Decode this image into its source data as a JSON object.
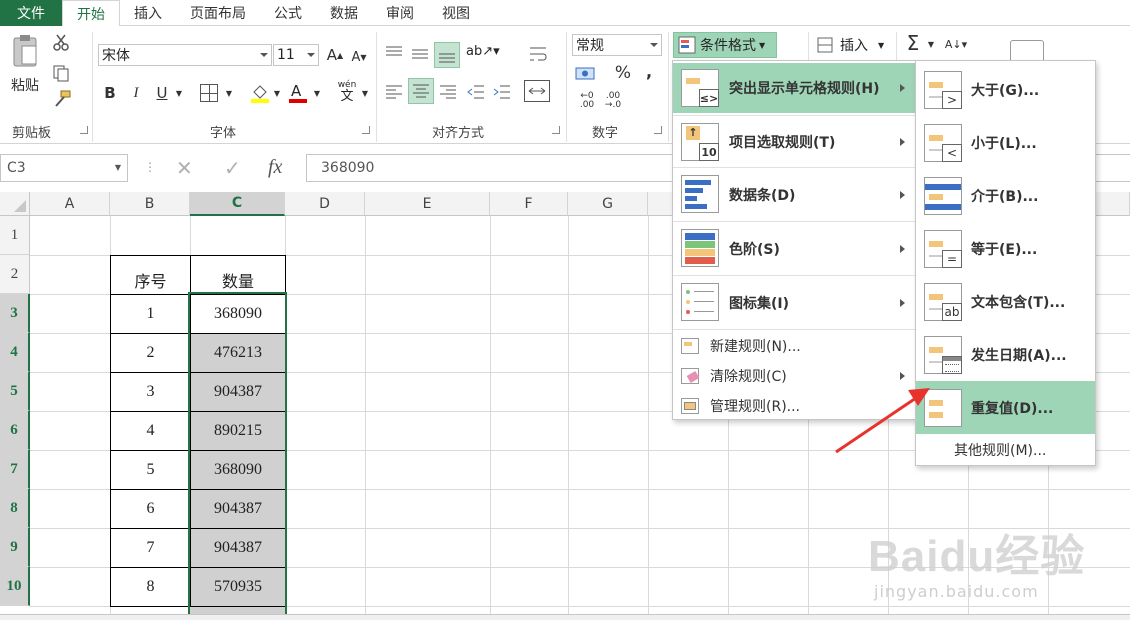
{
  "menubar": {
    "file": "文件",
    "tabs": [
      "开始",
      "插入",
      "页面布局",
      "公式",
      "数据",
      "审阅",
      "视图"
    ]
  },
  "ribbon": {
    "paste": "粘贴",
    "clipboard": "剪贴板",
    "font_name": "宋体",
    "font_size": "11",
    "font_group": "字体",
    "align_group": "对齐方式",
    "number_format": "常规",
    "number_group": "数字",
    "cond_format": "条件格式",
    "insert": "插入",
    "wen": "wén",
    "wen_char": "文"
  },
  "formula_bar": {
    "name_box": "C3",
    "fx": "fx",
    "value": "368090"
  },
  "columns": [
    "A",
    "B",
    "C",
    "D",
    "E",
    "F",
    "G"
  ],
  "rows": [
    "1",
    "2",
    "3",
    "4",
    "5",
    "6",
    "7",
    "8",
    "9",
    "10"
  ],
  "table": {
    "header_b": "序号",
    "header_c": "数量",
    "index": [
      "1",
      "2",
      "3",
      "4",
      "5",
      "6",
      "7",
      "8"
    ],
    "qty": [
      "368090",
      "476213",
      "904387",
      "890215",
      "368090",
      "904387",
      "904387",
      "570935"
    ]
  },
  "menu1": {
    "items": [
      "突出显示单元格规则(H)",
      "项目选取规则(T)",
      "数据条(D)",
      "色阶(S)",
      "图标集(I)"
    ],
    "top10_icon": "10",
    "simple": [
      "新建规则(N)...",
      "清除规则(C)",
      "管理规则(R)..."
    ]
  },
  "menu2": {
    "items": [
      "大于(G)...",
      "小于(L)...",
      "介于(B)...",
      "等于(E)...",
      "文本包含(T)...",
      "发生日期(A)...",
      "重复值(D)..."
    ],
    "badges": [
      ">",
      "<",
      "",
      "=",
      "ab",
      "",
      ""
    ],
    "other": "其他规则(M)..."
  },
  "watermark": {
    "big": "Baidu经验",
    "small": "jingyan.baidu.com"
  },
  "colors": {
    "excel_green": "#217346",
    "menu_highlight": "#9fd5b7",
    "arrow_red": "#e8332d"
  }
}
